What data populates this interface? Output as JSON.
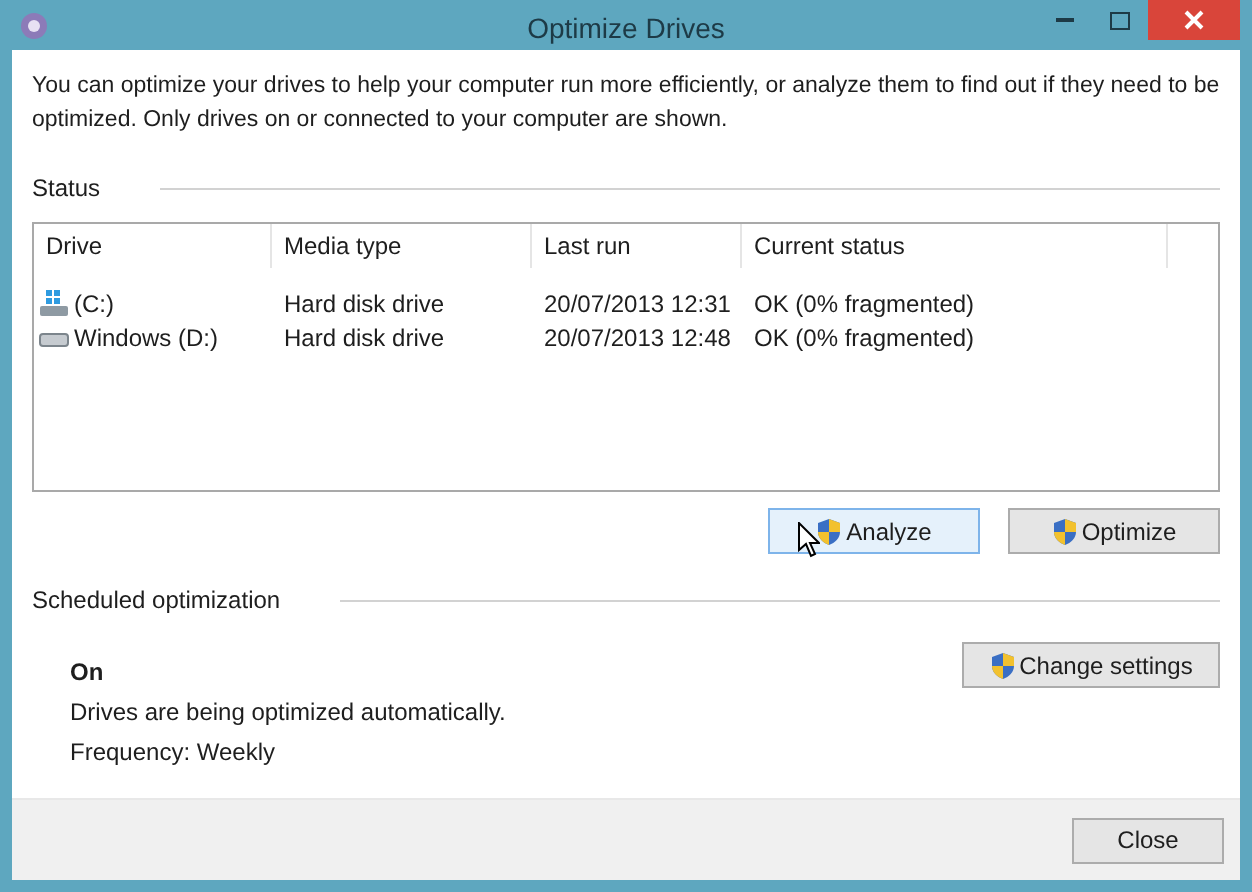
{
  "window": {
    "title": "Optimize Drives"
  },
  "description": "You can optimize your drives to help your computer run more efficiently, or analyze them to find out if they need to be optimized. Only drives on or connected to your computer are shown.",
  "status": {
    "heading": "Status",
    "columns": [
      "Drive",
      "Media type",
      "Last run",
      "Current status"
    ],
    "rows": [
      {
        "drive": "(C:)",
        "kind": "system",
        "media_type": "Hard disk drive",
        "last_run": "20/07/2013 12:31",
        "current_status": "OK (0% fragmented)"
      },
      {
        "drive": "Windows (D:)",
        "kind": "disk",
        "media_type": "Hard disk drive",
        "last_run": "20/07/2013 12:48",
        "current_status": "OK (0% fragmented)"
      }
    ],
    "buttons": [
      {
        "label": "Analyze",
        "hovered": true
      },
      {
        "label": "Optimize",
        "hovered": false
      }
    ]
  },
  "scheduled": {
    "heading": "Scheduled optimization",
    "state": "On",
    "message": "Drives are being optimized automatically.",
    "frequency": "Frequency: Weekly",
    "button": "Change settings"
  },
  "footer": {
    "button": "Close"
  }
}
